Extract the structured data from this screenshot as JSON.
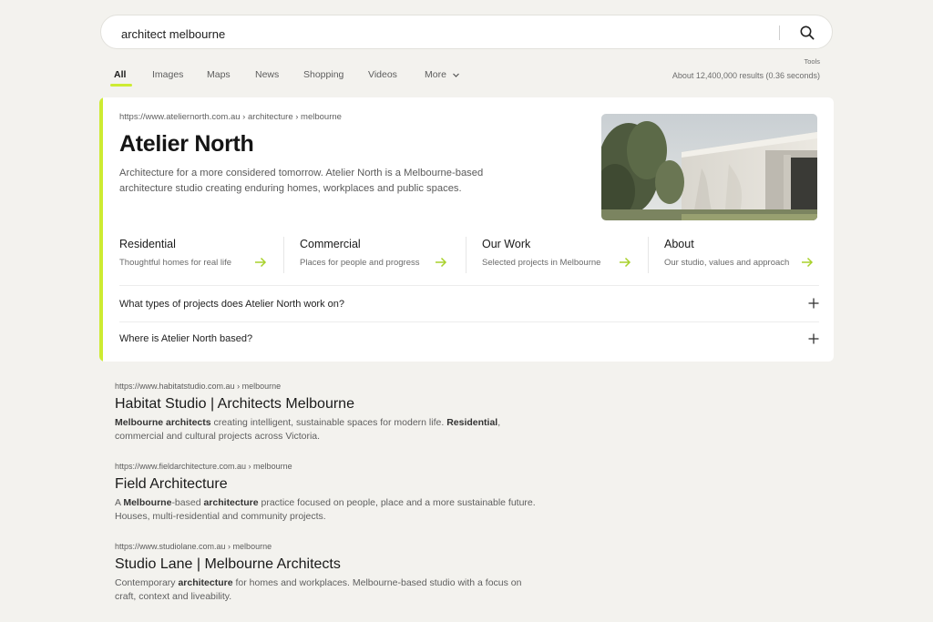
{
  "search": {
    "query": "architect melbourne"
  },
  "tabs": [
    {
      "label": "All"
    },
    {
      "label": "Images"
    },
    {
      "label": "Maps"
    },
    {
      "label": "News"
    },
    {
      "label": "Shopping"
    },
    {
      "label": "Videos"
    },
    {
      "label": "More"
    }
  ],
  "tools_label": "Tools",
  "results_count": "About 12,400,000 results (0.36 seconds)",
  "featured": {
    "breadcrumb": "https://www.ateliernorth.com.au › architecture › melbourne",
    "title": "Atelier North",
    "description": "Architecture for a more considered tomorrow. Atelier North is a Melbourne-based architecture studio creating enduring homes, workplaces and public spaces.",
    "sitelinks": [
      {
        "title": "Residential",
        "desc": "Thoughtful homes for real life"
      },
      {
        "title": "Commercial",
        "desc": "Places for people and progress"
      },
      {
        "title": "Our Work",
        "desc": "Selected projects in Melbourne"
      },
      {
        "title": "About",
        "desc": "Our studio, values and approach"
      }
    ],
    "faqs": [
      {
        "q": "What types of projects does Atelier North work on?"
      },
      {
        "q": "Where is Atelier North based?"
      }
    ]
  },
  "results": [
    {
      "url": "https://www.habitatstudio.com.au › melbourne",
      "title": "Habitat Studio | Architects Melbourne",
      "snippet": [
        {
          "t": "Melbourne architects",
          "b": true
        },
        {
          "t": " creating intelligent, sustainable spaces for modern life. ",
          "b": false
        },
        {
          "t": "Residential",
          "b": true
        },
        {
          "t": ", commercial and cultural projects across Victoria.",
          "b": false
        }
      ]
    },
    {
      "url": "https://www.fieldarchitecture.com.au › melbourne",
      "title": "Field Architecture",
      "snippet": [
        {
          "t": "A ",
          "b": false
        },
        {
          "t": "Melbourne",
          "b": true
        },
        {
          "t": "-based ",
          "b": false
        },
        {
          "t": "architecture",
          "b": true
        },
        {
          "t": " practice focused on people, place and a more sustainable future. Houses, multi-residential and community projects.",
          "b": false
        }
      ]
    },
    {
      "url": "https://www.studiolane.com.au › melbourne",
      "title": "Studio Lane | Melbourne Architects",
      "snippet": [
        {
          "t": "Contemporary ",
          "b": false
        },
        {
          "t": "architecture",
          "b": true
        },
        {
          "t": " for homes and workplaces. Melbourne-based studio with a focus on craft, context and liveability.",
          "b": false
        }
      ]
    }
  ],
  "colors": {
    "accent": "#cdeb32",
    "arrow": "#a8d12a",
    "background": "#f3f2ee"
  }
}
